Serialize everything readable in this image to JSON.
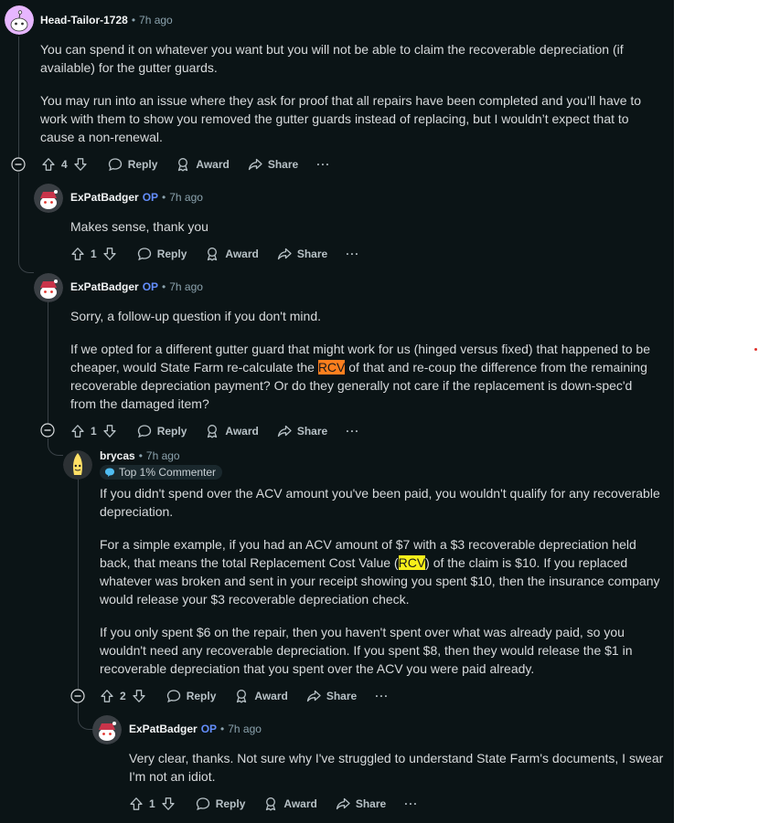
{
  "comments": [
    {
      "user": "Head-Tailor-1728",
      "op": "",
      "time": "7h ago",
      "paragraphs": [
        "You can spend it on whatever you want but you will not be able to claim the recoverable depreciation (if available) for the gutter guards.",
        "You may run into an issue where they ask for proof that all repairs have been completed and you’ll have to work with them to show you removed the gutter guards instead of replacing, but I wouldn’t expect that to cause a non-renewal."
      ],
      "votes": "4"
    },
    {
      "user": "ExPatBadger",
      "op": "OP",
      "time": "7h ago",
      "paragraphs": [
        "Makes sense, thank you"
      ],
      "votes": "1"
    },
    {
      "user": "ExPatBadger",
      "op": "OP",
      "time": "7h ago",
      "paragraphs": [
        "Sorry, a follow-up question if you don't mind.",
        "If we opted for a different gutter guard that might work for us (hinged versus fixed) that happened to be cheaper, would State Farm re-calculate the ",
        "RCV",
        " of that and re-coup the difference from the remaining recoverable depreciation payment? Or do they generally not care if the replacement is down-spec'd from the damaged item?"
      ],
      "votes": "1"
    },
    {
      "user": "brycas",
      "op": "",
      "time": "7h ago",
      "badge": "Top 1% Commenter",
      "paragraphs": [
        "If you didn't spend over the ACV amount you've been paid, you wouldn't qualify for any recoverable depreciation.",
        "For a simple example, if you had an ACV amount of $7 with a $3 recoverable depreciation held back, that means the total Replacement Cost Value (",
        "RCV",
        ") of the claim is $10. If you replaced whatever was broken and sent in your receipt showing you spent $10, then the insurance company would release your $3 recoverable depreciation check.",
        "If you only spent $6 on the repair, then you haven't spent over what was already paid, so you wouldn't need any recoverable depreciation. If you spent $8, then they would release the $1 in recoverable depreciation that you spent over the ACV you were paid already."
      ],
      "votes": "2"
    },
    {
      "user": "ExPatBadger",
      "op": "OP",
      "time": "7h ago",
      "paragraphs": [
        "Very clear, thanks. Not sure why I've struggled to understand State Farm's documents, I swear I'm not an idiot."
      ],
      "votes": "1"
    }
  ],
  "actions": {
    "reply": "Reply",
    "award": "Award",
    "share": "Share",
    "more": "···"
  },
  "colors": {
    "background": "#0b1416",
    "op_accent": "#648efc",
    "rcv_highlight_orange": "#ff7f1e",
    "rcv_highlight_yellow": "#f7ee1a"
  }
}
